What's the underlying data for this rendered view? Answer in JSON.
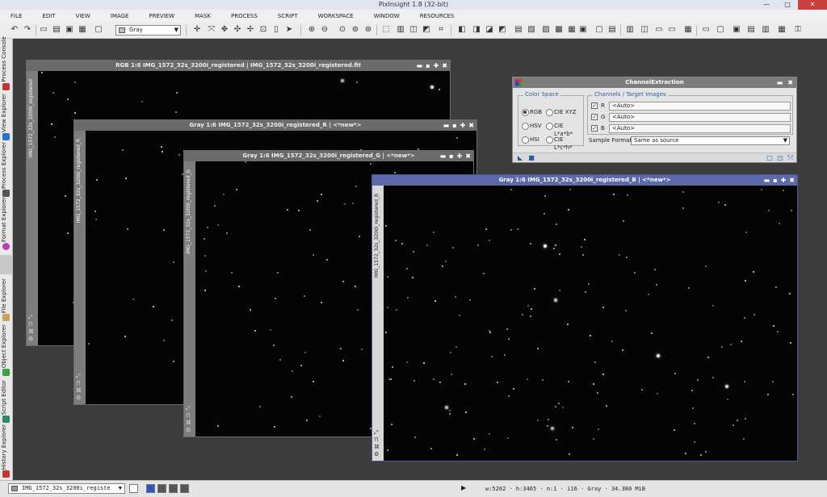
{
  "window": {
    "title": "PixInsight 1.8 (32-bit)",
    "minimize": "—",
    "maximize": "□",
    "close": "✕"
  },
  "menu": [
    "FILE",
    "EDIT",
    "VIEW",
    "IMAGE",
    "PREVIEW",
    "MASK",
    "PROCESS",
    "SCRIPT",
    "WORKSPACE",
    "WINDOW",
    "RESOURCES"
  ],
  "toolbar": {
    "color_space_combo": "Gray"
  },
  "sidebar": [
    {
      "label": "Process Console",
      "color": "#c0392b"
    },
    {
      "label": "View Explorer",
      "color": "#2d6fc9"
    },
    {
      "label": "Process Explorer",
      "color": "#555555"
    },
    {
      "label": "Format Explorer",
      "color": "#b83db8"
    },
    {
      "label": "File Explorer",
      "color": "#c8a060"
    },
    {
      "label": "Object Explorer",
      "color": "#3aa23a"
    },
    {
      "label": "Script Editor",
      "color": "#2a8a6a"
    },
    {
      "label": "History Explorer",
      "color": "#c0392b"
    }
  ],
  "windows": [
    {
      "title": "RGB 1:6 IMG_1572_32s_3200i_registered | IMG_1572_32s_3200i_registered.fit",
      "id": "IMG_1572_32s_3200i_registered"
    },
    {
      "title": "Gray 1:6 IMG_1572_32s_3200i_registered_R | <*new*>",
      "id": "IMG_1572_32s_3200i_registered_R"
    },
    {
      "title": "Gray 1:6 IMG_1572_32s_3200i_registered_G | <*new*>",
      "id": "IMG_1572_32s_3200i_registered_G"
    },
    {
      "title": "Gray 1:6 IMG_1572_32s_3200i_registered_B | <*new*>",
      "id": "IMG_1572_32s_3200i_registered_B"
    }
  ],
  "window_buttons": {
    "shade": "▬",
    "iconize": "▪",
    "maximize": "✚",
    "close": "✖"
  },
  "panel": {
    "title": "ChannelExtraction",
    "color_space": {
      "label": "Color Space",
      "options": [
        "RGB",
        "HSV",
        "HSI",
        "CIE XYZ",
        "CIE L*a*b*",
        "CIE L*c*h*"
      ],
      "selected": "RGB"
    },
    "channels": {
      "label": "Channels / Target Images",
      "rows": [
        {
          "name": "R",
          "value": "<Auto>",
          "checked": true
        },
        {
          "name": "G",
          "value": "<Auto>",
          "checked": true
        },
        {
          "name": "B",
          "value": "<Auto>",
          "checked": true
        }
      ]
    },
    "sample_format": {
      "label": "Sample Format:",
      "value": "Same as source"
    }
  },
  "statusbar": {
    "view": "IMG_1572_32s_3200i_registe",
    "info": "w:5202 · h:3465 · n:1 · i16 · Gray · 34.380 MiB"
  }
}
